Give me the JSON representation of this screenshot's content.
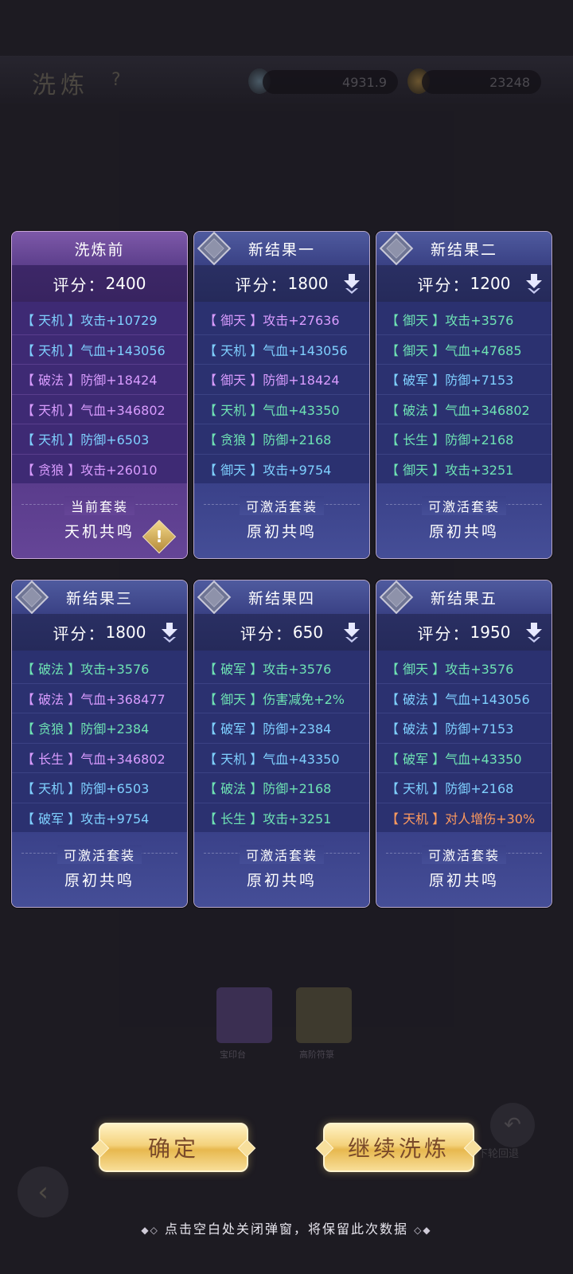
{
  "background": {
    "title": "洗炼",
    "resource_one": "4931.9",
    "resource_two": "23248",
    "icon_a_label": "宝印台",
    "icon_b_label": "高阶符箓",
    "undo_label": "下轮回退"
  },
  "cards": [
    {
      "title": "洗炼前",
      "score_label": "评分：",
      "score": "2400",
      "attrs": [
        {
          "tag": "天机",
          "text": "攻击+10729"
        },
        {
          "tag": "天机",
          "text": "气血+143056"
        },
        {
          "tag": "破法",
          "text": "防御+18424"
        },
        {
          "tag": "天机",
          "text": "气血+346802"
        },
        {
          "tag": "天机",
          "text": "防御+6503"
        },
        {
          "tag": "贪狼",
          "text": "攻击+26010"
        }
      ],
      "suit_title": "当前套装",
      "suit_name": "天机共鸣"
    },
    {
      "title": "新结果一",
      "score_label": "评分：",
      "score": "1800",
      "attrs": [
        {
          "tag": "御天",
          "text": "攻击+27636"
        },
        {
          "tag": "天机",
          "text": "气血+143056"
        },
        {
          "tag": "御天",
          "text": "防御+18424"
        },
        {
          "tag": "天机",
          "text": "气血+43350"
        },
        {
          "tag": "贪狼",
          "text": "防御+2168"
        },
        {
          "tag": "御天",
          "text": "攻击+9754"
        }
      ],
      "suit_title": "可激活套装",
      "suit_name": "原初共鸣"
    },
    {
      "title": "新结果二",
      "score_label": "评分：",
      "score": "1200",
      "attrs": [
        {
          "tag": "御天",
          "text": "攻击+3576"
        },
        {
          "tag": "御天",
          "text": "气血+47685"
        },
        {
          "tag": "破军",
          "text": "防御+7153"
        },
        {
          "tag": "破法",
          "text": "气血+346802"
        },
        {
          "tag": "长生",
          "text": "防御+2168"
        },
        {
          "tag": "御天",
          "text": "攻击+3251"
        }
      ],
      "suit_title": "可激活套装",
      "suit_name": "原初共鸣"
    },
    {
      "title": "新结果三",
      "score_label": "评分：",
      "score": "1800",
      "attrs": [
        {
          "tag": "破法",
          "text": "攻击+3576"
        },
        {
          "tag": "破法",
          "text": "气血+368477"
        },
        {
          "tag": "贪狼",
          "text": "防御+2384"
        },
        {
          "tag": "长生",
          "text": "气血+346802"
        },
        {
          "tag": "天机",
          "text": "防御+6503"
        },
        {
          "tag": "破军",
          "text": "攻击+9754"
        }
      ],
      "suit_title": "可激活套装",
      "suit_name": "原初共鸣"
    },
    {
      "title": "新结果四",
      "score_label": "评分：",
      "score": "650",
      "attrs": [
        {
          "tag": "破军",
          "text": "攻击+3576"
        },
        {
          "tag": "御天",
          "text": "伤害减免+2%"
        },
        {
          "tag": "破军",
          "text": "防御+2384"
        },
        {
          "tag": "天机",
          "text": "气血+43350"
        },
        {
          "tag": "破法",
          "text": "防御+2168"
        },
        {
          "tag": "长生",
          "text": "攻击+3251"
        }
      ],
      "suit_title": "可激活套装",
      "suit_name": "原初共鸣"
    },
    {
      "title": "新结果五",
      "score_label": "评分：",
      "score": "1950",
      "attrs": [
        {
          "tag": "御天",
          "text": "攻击+3576"
        },
        {
          "tag": "破法",
          "text": "气血+143056"
        },
        {
          "tag": "破法",
          "text": "防御+7153"
        },
        {
          "tag": "破军",
          "text": "气血+43350"
        },
        {
          "tag": "天机",
          "text": "防御+2168"
        },
        {
          "tag": "天机",
          "text": "对人增伤+30%"
        }
      ],
      "suit_title": "可激活套装",
      "suit_name": "原初共鸣"
    }
  ],
  "buttons": {
    "confirm": "确定",
    "continue": "继续洗炼"
  },
  "hint": "点击空白处关闭弹窗，将保留此次数据"
}
